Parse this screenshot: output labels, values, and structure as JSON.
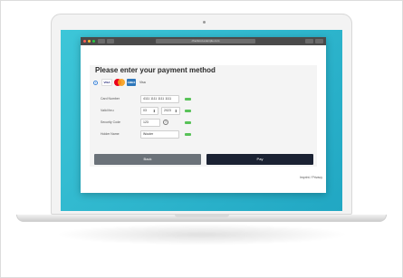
{
  "browser": {
    "url": "checkout.example.com"
  },
  "payment": {
    "title": "Please enter your payment method",
    "selected_brand_label": "Visa",
    "brands": {
      "visa": "VISA",
      "amex": "AMEX"
    },
    "fields": {
      "card_number": {
        "label": "Card Number",
        "value": "4111 1111 1111 1111"
      },
      "valid_thru": {
        "label": "Valid thru",
        "month": "03",
        "year": "2023"
      },
      "security_code": {
        "label": "Security Code",
        "value": "123",
        "help": "?"
      },
      "holder_name": {
        "label": "Holder Name",
        "value": "Wouter"
      }
    },
    "back_label": "Back",
    "pay_label": "Pay"
  },
  "footer": {
    "imprint": "Imprint / Privacy"
  },
  "colors": {
    "screen_bg": "#2bb8cf",
    "pay_button": "#1b2233",
    "back_button": "#6b7279",
    "valid_indicator": "#58c258",
    "radio_accent": "#3a83d8"
  }
}
